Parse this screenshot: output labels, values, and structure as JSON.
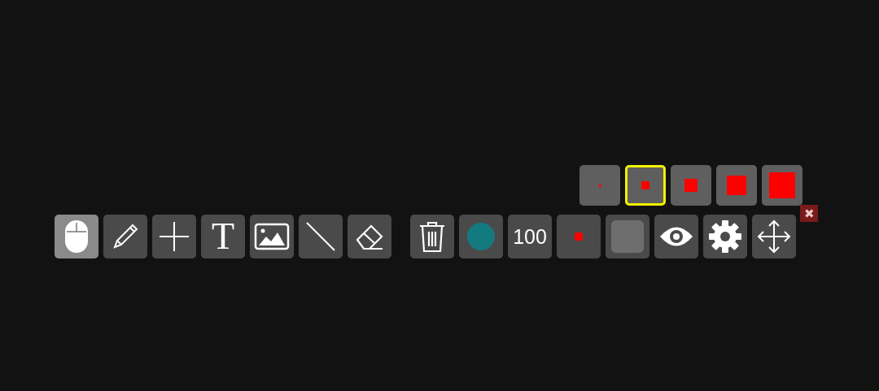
{
  "size_options": [
    {
      "selected": false
    },
    {
      "selected": true
    },
    {
      "selected": false
    },
    {
      "selected": false
    },
    {
      "selected": false
    }
  ],
  "tools": [
    {
      "kind": "pointer",
      "selected": true
    },
    {
      "kind": "pencil",
      "selected": false
    },
    {
      "kind": "crosshair",
      "selected": false
    },
    {
      "kind": "text",
      "label": "T",
      "selected": false
    },
    {
      "kind": "image",
      "selected": false
    },
    {
      "kind": "line",
      "selected": false
    },
    {
      "kind": "eraser",
      "selected": false
    }
  ],
  "actions": [
    {
      "kind": "delete"
    },
    {
      "kind": "color",
      "color": "#137a80"
    },
    {
      "kind": "opacity",
      "label": "100"
    },
    {
      "kind": "size"
    },
    {
      "kind": "fill"
    },
    {
      "kind": "visibility"
    },
    {
      "kind": "settings"
    },
    {
      "kind": "move"
    }
  ],
  "close": {
    "label": "✖"
  }
}
